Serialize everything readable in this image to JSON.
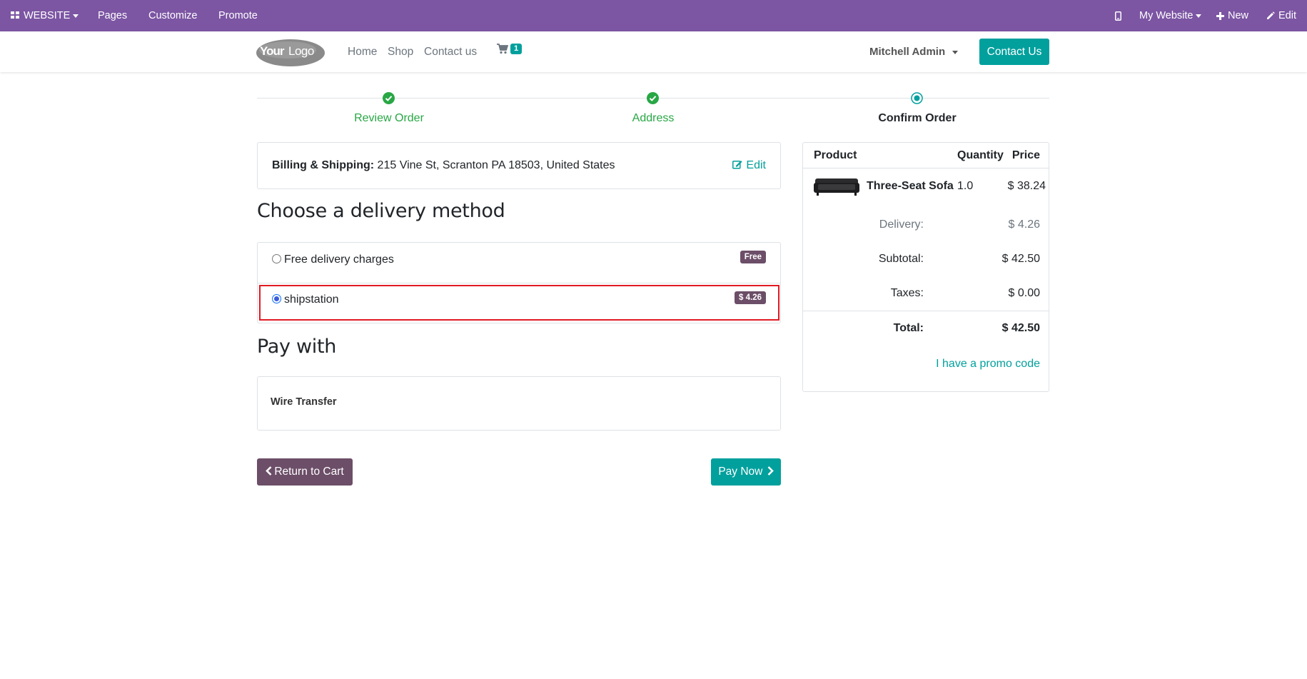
{
  "admin_bar": {
    "website_label": "WEBSITE",
    "pages_label": "Pages",
    "customize_label": "Customize",
    "promote_label": "Promote",
    "my_website_label": "My Website",
    "new_label": "New",
    "edit_label": "Edit",
    "background_color": "#7c55a3"
  },
  "header": {
    "logo_text": "YourLogo",
    "nav": [
      "Home",
      "Shop",
      "Contact us"
    ],
    "cart_count": "1",
    "user_name": "Mitchell Admin",
    "contact_button": "Contact Us",
    "accent_color": "#01a09d"
  },
  "wizard": {
    "steps": [
      {
        "label": "Review Order",
        "state": "done"
      },
      {
        "label": "Address",
        "state": "done"
      },
      {
        "label": "Confirm Order",
        "state": "current"
      }
    ]
  },
  "billing": {
    "label": "Billing & Shipping:",
    "address": "215 Vine St, Scranton PA 18503, United States",
    "edit_label": "Edit"
  },
  "delivery": {
    "title": "Choose a delivery method",
    "options": [
      {
        "label": "Free delivery charges",
        "badge": "Free",
        "selected": false
      },
      {
        "label": "shipstation",
        "badge": "$ 4.26",
        "selected": true
      }
    ]
  },
  "payment": {
    "title": "Pay with",
    "method": "Wire Transfer"
  },
  "actions": {
    "return_label": "Return to Cart",
    "pay_label": "Pay Now"
  },
  "summary": {
    "headers": {
      "product": "Product",
      "quantity": "Quantity",
      "price": "Price"
    },
    "line": {
      "name": "Three-Seat Sofa",
      "quantity": "1.0",
      "price": "$ 38.24"
    },
    "delivery_label": "Delivery:",
    "delivery_value": "$ 4.26",
    "subtotal_label": "Subtotal:",
    "subtotal_value": "$ 42.50",
    "taxes_label": "Taxes:",
    "taxes_value": "$ 0.00",
    "total_label": "Total:",
    "total_value": "$ 42.50",
    "promo_label": "I have a promo code"
  }
}
